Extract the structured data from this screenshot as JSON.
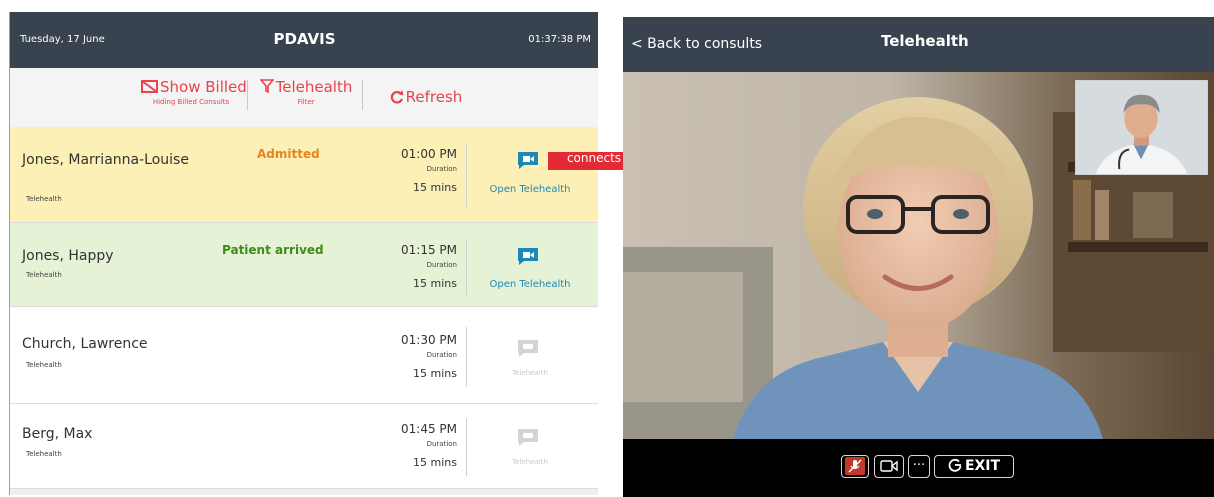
{
  "left_panel": {
    "header": {
      "date": "Tuesday, 17 June",
      "user": "PDAVIS",
      "clock": "01:37:38 PM"
    },
    "toolbar": {
      "show_billed": {
        "label": "Show Billed",
        "sub": "Hiding Billed Consults"
      },
      "telehealth": {
        "label": "Telehealth",
        "sub": "Filter"
      },
      "refresh": {
        "label": "Refresh"
      }
    },
    "consults": [
      {
        "name": "Jones, Marrianna-Louise",
        "type": "Telehealth",
        "status": "Admitted",
        "time": "01:00 PM",
        "duration_label": "Duration",
        "duration": "15 mins",
        "action": "Open Telehealth",
        "bg": "#fdf0b6"
      },
      {
        "name": "Jones, Happy",
        "type": "Telehealth",
        "status": "Patient arrived",
        "time": "01:15 PM",
        "duration_label": "Duration",
        "duration": "15 mins",
        "action": "Open Telehealth",
        "bg": "#e6f2d6"
      },
      {
        "name": "Church, Lawrence",
        "type": "Telehealth",
        "status": "",
        "time": "01:30 PM",
        "duration_label": "Duration",
        "duration": "15 mins",
        "action": "Telehealth",
        "bg": "#ffffff"
      },
      {
        "name": "Berg, Max",
        "type": "Telehealth",
        "status": "",
        "time": "01:45 PM",
        "duration_label": "Duration",
        "duration": "15 mins",
        "action": "Telehealth",
        "bg": "#ffffff"
      }
    ]
  },
  "annotation": {
    "label": "connects"
  },
  "right_panel": {
    "header": {
      "back": "< Back to consults",
      "title": "Telehealth"
    },
    "controls": {
      "exit": "EXIT",
      "more": "···"
    }
  },
  "colors": {
    "header_bg": "#38434f",
    "accent_red": "#e8434a",
    "teal": "#1e88b5",
    "admitted": "#e8831d",
    "arrived": "#3f8a1c"
  },
  "icons": [
    "no-billing-icon",
    "funnel-icon",
    "refresh-icon",
    "video-chat-icon",
    "mic-muted-icon",
    "camera-icon",
    "exit-icon"
  ]
}
